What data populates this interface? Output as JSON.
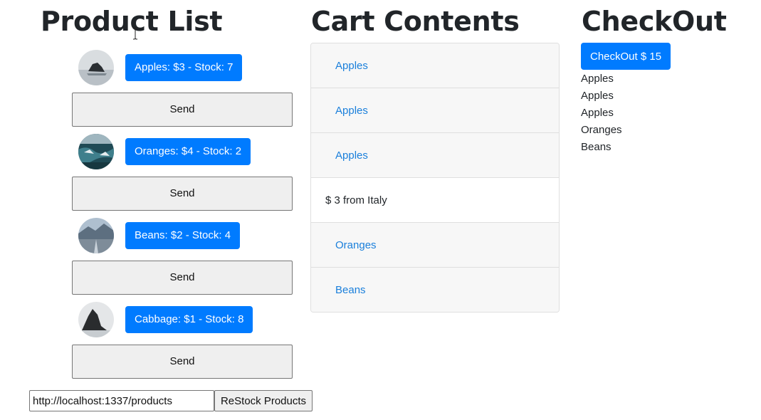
{
  "headings": {
    "products": "Product List",
    "cart": "Cart Contents",
    "checkout": "CheckOut"
  },
  "products": [
    {
      "label": "Apples: $3 - Stock: 7",
      "send_label": "Send",
      "image_icon": "lake-rock-photo"
    },
    {
      "label": "Oranges: $4 - Stock: 2",
      "send_label": "Send",
      "image_icon": "coastal-rocks-photo"
    },
    {
      "label": "Beans: $2 - Stock: 4",
      "send_label": "Send",
      "image_icon": "mountain-road-photo"
    },
    {
      "label": "Cabbage: $1 - Stock: 8",
      "send_label": "Send",
      "image_icon": "dark-rock-photo"
    }
  ],
  "cart": {
    "items": [
      {
        "label": "Apples"
      },
      {
        "label": "Apples"
      },
      {
        "label": "Apples"
      },
      {
        "detail": "$ 3 from Italy"
      },
      {
        "label": "Oranges"
      },
      {
        "label": "Beans"
      }
    ]
  },
  "checkout": {
    "button_label": "CheckOut $ 15",
    "items": [
      "Apples",
      "Apples",
      "Apples",
      "Oranges",
      "Beans"
    ]
  },
  "restock": {
    "url_value": "http://localhost:1337/products",
    "button_label": "ReStock Products"
  },
  "colors": {
    "primary": "#007bff",
    "link": "#1a7fdb",
    "list_bg": "#f7f7f7"
  }
}
